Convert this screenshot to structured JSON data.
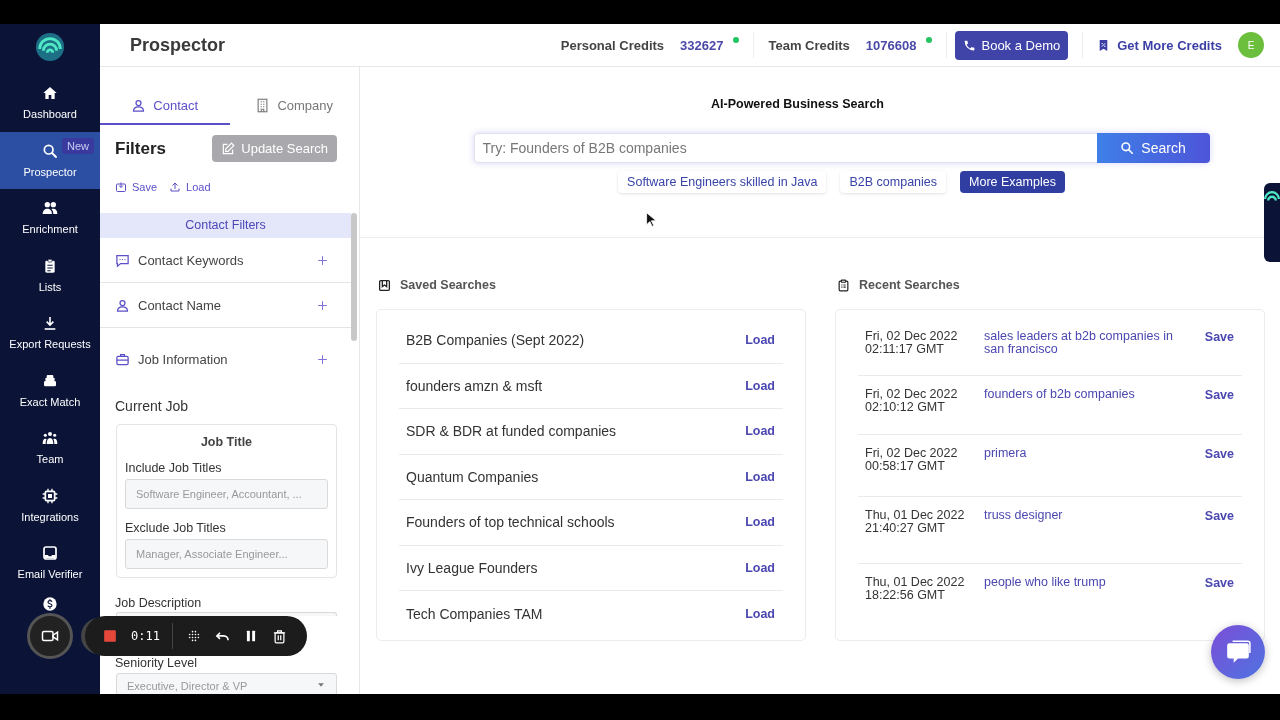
{
  "sidebar": {
    "items": [
      {
        "label": "Dashboard",
        "selected": false
      },
      {
        "label": "Prospector",
        "badge": "New",
        "selected": true
      },
      {
        "label": "Enrichment",
        "selected": false
      },
      {
        "label": "Lists",
        "selected": false
      },
      {
        "label": "Export Requests",
        "selected": false
      },
      {
        "label": "Exact Match",
        "selected": false
      },
      {
        "label": "Team",
        "selected": false
      },
      {
        "label": "Integrations",
        "selected": false
      },
      {
        "label": "Email Verifier",
        "selected": false
      },
      {
        "selected": false
      }
    ]
  },
  "header": {
    "title": "Prospector",
    "credits": [
      {
        "label": "Personal Credits",
        "value": "332627"
      },
      {
        "label": "Team Credits",
        "value": "1076608"
      }
    ],
    "demo_button": "Book a Demo",
    "credits_link": "Get More Credits",
    "avatar": "E"
  },
  "filters": {
    "tabs": [
      {
        "label": "Contact",
        "selected": true
      },
      {
        "label": "Company",
        "selected": false
      }
    ],
    "heading": "Filters",
    "update_button": {
      "label": "Update Search",
      "disabled": true
    },
    "actions": [
      "Save",
      "Load"
    ],
    "section_title": "Contact Filters",
    "groups": [
      {
        "label": "Contact Keywords"
      },
      {
        "label": "Contact Name"
      },
      {
        "label": "Job Information"
      }
    ],
    "current_job": {
      "heading": "Current Job",
      "card_title": "Job Title",
      "fields": [
        {
          "label": "Include Job Titles",
          "placeholder": "Software Engineer, Accountant, ..."
        },
        {
          "label": "Exclude Job Titles",
          "placeholder": "Manager, Associate Engineer..."
        }
      ]
    },
    "job_description": {
      "label": "Job Description"
    },
    "seniority": {
      "label": "Seniority Level",
      "placeholder": "Executive, Director & VP"
    }
  },
  "search": {
    "title": "AI-Powered Business Search",
    "placeholder": "Try: Founders of B2B companies",
    "button": "Search",
    "suggestions": [
      {
        "label": "Software Engineers skilled in Java",
        "kind": "example"
      },
      {
        "label": "B2B companies",
        "kind": "example"
      },
      {
        "label": "More Examples",
        "kind": "more"
      }
    ]
  },
  "saved_searches": {
    "title": "Saved Searches",
    "rows": [
      {
        "name": "B2B Companies (Sept 2022)",
        "action": "Load"
      },
      {
        "name": "founders amzn & msft",
        "action": "Load"
      },
      {
        "name": "SDR & BDR at funded companies",
        "action": "Load"
      },
      {
        "name": "Quantum Companies",
        "action": "Load"
      },
      {
        "name": "Founders of top technical schools",
        "action": "Load"
      },
      {
        "name": "Ivy League Founders",
        "action": "Load"
      },
      {
        "name": "Tech Companies TAM",
        "action": "Load"
      }
    ]
  },
  "recent_searches": {
    "title": "Recent Searches",
    "rows": [
      {
        "time": "Fri, 02 Dec 2022 02:11:17 GMT",
        "query": "sales leaders at b2b companies in san francisco",
        "action": "Save"
      },
      {
        "time": "Fri, 02 Dec 2022 02:10:12 GMT",
        "query": "founders of b2b companies",
        "action": "Save"
      },
      {
        "time": "Fri, 02 Dec 2022 00:58:17 GMT",
        "query": "primera",
        "action": "Save"
      },
      {
        "time": "Thu, 01 Dec 2022 21:40:27 GMT",
        "query": "truss designer",
        "action": "Save"
      },
      {
        "time": "Thu, 01 Dec 2022 18:22:56 GMT",
        "query": "people who like trump",
        "action": "Save"
      }
    ]
  },
  "recorder": {
    "time": "0:11"
  }
}
